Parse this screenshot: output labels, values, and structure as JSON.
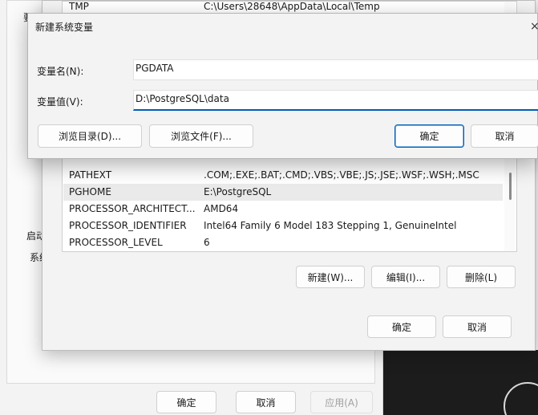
{
  "sysprops": {
    "fragment_top": "要",
    "fragment_mid": "启动",
    "fragment_low": "系统",
    "ok_label": "确定",
    "cancel_label": "取消",
    "apply_label": "应用(A)"
  },
  "env_dialog": {
    "top_row": {
      "name": "TMP",
      "value": "C:\\Users\\28648\\AppData\\Local\\Temp"
    },
    "rows": [
      {
        "name": "PATHEXT",
        "value": ".COM;.EXE;.BAT;.CMD;.VBS;.VBE;.JS;.JSE;.WSF;.WSH;.MSC"
      },
      {
        "name": "PGHOME",
        "value": "E:\\PostgreSQL"
      },
      {
        "name": "PROCESSOR_ARCHITECT...",
        "value": "AMD64"
      },
      {
        "name": "PROCESSOR_IDENTIFIER",
        "value": "Intel64 Family 6 Model 183 Stepping 1, GenuineIntel"
      },
      {
        "name": "PROCESSOR_LEVEL",
        "value": "6"
      }
    ],
    "new_label": "新建(W)...",
    "edit_label": "编辑(I)...",
    "delete_label": "删除(L)",
    "ok_label": "确定",
    "cancel_label": "取消"
  },
  "new_var_dialog": {
    "title": "新建系统变量",
    "name_label": "变量名(N):",
    "name_value": "PGDATA",
    "value_label": "变量值(V):",
    "value_value": "D:\\PostgreSQL\\data",
    "browse_dir_label": "浏览目录(D)...",
    "browse_file_label": "浏览文件(F)...",
    "ok_label": "确定",
    "cancel_label": "取消",
    "close_icon": "×"
  }
}
